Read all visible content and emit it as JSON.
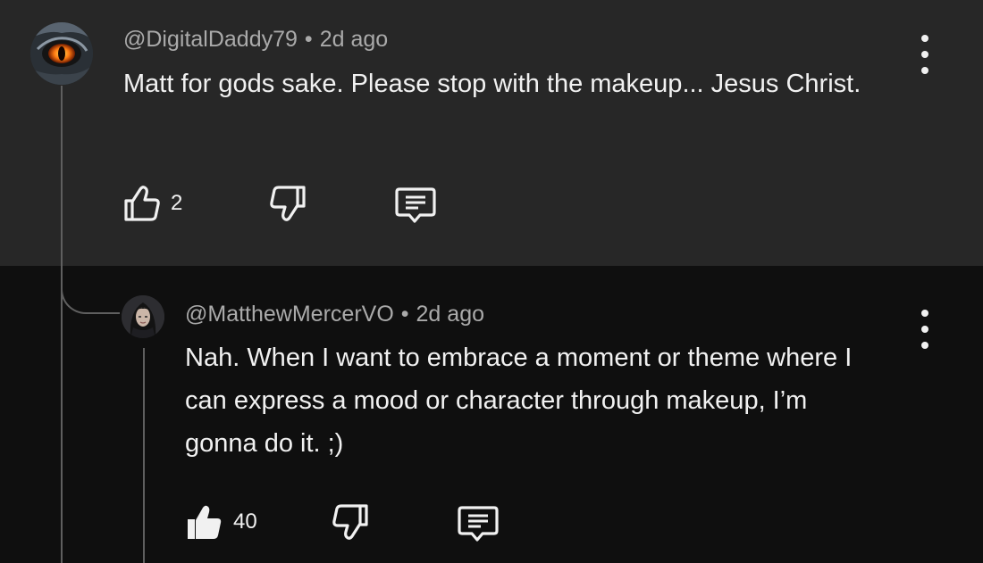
{
  "comments": [
    {
      "handle": "@DigitalDaddy79",
      "separator": "•",
      "time": "2d ago",
      "text": "Matt for gods sake.  Please stop with the makeup... Jesus Christ.",
      "likes": "2",
      "avatar_icon": "orange-eye-avatar"
    }
  ],
  "replies": [
    {
      "handle": "@MatthewMercerVO",
      "separator": "•",
      "time": "2d ago",
      "text": "Nah. When I want to embrace a moment or theme where I can express a mood or character through makeup, I’m gonna do it. ;)",
      "likes": "40",
      "liked": true,
      "avatar_icon": "long-hair-portrait-avatar"
    }
  ],
  "icons": {
    "like": "thumbs-up-icon",
    "dislike": "thumbs-down-icon",
    "reply": "reply-comment-icon",
    "menu": "more-vertical-icon"
  },
  "colors": {
    "parent_bg": "#272727",
    "reply_bg": "#0f0f0f",
    "meta_text": "#aaaaaa",
    "primary_text": "#f1f1f1"
  }
}
